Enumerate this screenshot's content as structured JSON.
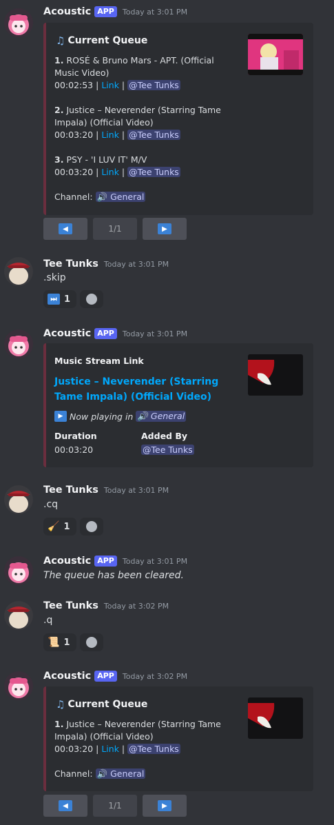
{
  "colors": {
    "background": "#313338",
    "embed_bg": "#2b2d31",
    "embed_border": "#6b2e3e",
    "app_badge": "#5865f2",
    "link": "#00a8fc",
    "mention_bg": "#3c4270"
  },
  "icons": {
    "note": "music-note-icon",
    "play": "play-icon",
    "skip": "fast-forward-icon",
    "broom": "broom-icon",
    "scroll": "scroll-icon",
    "speaker": "speaker-icon",
    "emoji": "add-reaction-icon"
  },
  "msg1": {
    "username": "Acoustic",
    "badge": "APP",
    "timestamp": "Today at 3:01 PM",
    "embed": {
      "title": "Current Queue",
      "tracks": [
        {
          "num": "1.",
          "title": "ROSÉ & Bruno Mars - APT. (Official Music Video)",
          "duration": "00:02:53",
          "sep": "|",
          "link": "Link",
          "user": "@Tee Tunks"
        },
        {
          "num": "2.",
          "title": "Justice – Neverender (Starring Tame Impala) (Official Video)",
          "duration": "00:03:20",
          "sep": "|",
          "link": "Link",
          "user": "@Tee Tunks"
        },
        {
          "num": "3.",
          "title": "PSY - 'I LUV IT' M/V",
          "duration": "00:03:20",
          "sep": "|",
          "link": "Link",
          "user": "@Tee Tunks"
        }
      ],
      "channel_label": "Channel:",
      "channel": "General"
    },
    "pager": "1/1"
  },
  "msg2": {
    "username": "Tee Tunks",
    "timestamp": "Today at 3:01 PM",
    "text": ".skip",
    "reaction_count": "1"
  },
  "msg3": {
    "username": "Acoustic",
    "badge": "APP",
    "timestamp": "Today at 3:01 PM",
    "embed": {
      "header": "Music Stream Link",
      "title": "Justice – Neverender (Starring Tame Impala) (Official Video)",
      "now_playing": "Now playing in",
      "channel": "General",
      "duration_label": "Duration",
      "duration": "00:03:20",
      "added_label": "Added By",
      "added_by": "@Tee Tunks"
    }
  },
  "msg4": {
    "username": "Tee Tunks",
    "timestamp": "Today at 3:01 PM",
    "text": ".cq",
    "reaction_count": "1"
  },
  "msg5": {
    "username": "Acoustic",
    "badge": "APP",
    "timestamp": "Today at 3:01 PM",
    "text": "The queue has been cleared."
  },
  "msg6": {
    "username": "Tee Tunks",
    "timestamp": "Today at 3:02 PM",
    "text": ".q",
    "reaction_count": "1"
  },
  "msg7": {
    "username": "Acoustic",
    "badge": "APP",
    "timestamp": "Today at 3:02 PM",
    "embed": {
      "title": "Current Queue",
      "track": {
        "num": "1.",
        "title": "Justice – Neverender (Starring Tame Impala) (Official Video)",
        "duration": "00:03:20",
        "sep": "|",
        "link": "Link",
        "user": "@Tee Tunks"
      },
      "channel_label": "Channel:",
      "channel": "General"
    },
    "pager": "1/1"
  }
}
